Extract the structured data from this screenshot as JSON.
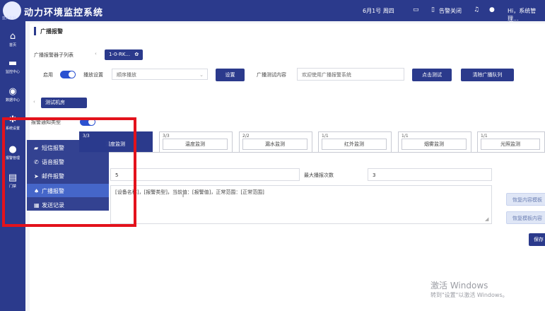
{
  "topbar": {
    "logo_sub": "蓝大化科",
    "title": "动力环境监控系统",
    "date": "6月1号 周四",
    "alarm_close": "告警关闭",
    "user": "Hi，系统管理..."
  },
  "sidebar": [
    {
      "label": "首页",
      "icon": "home-icon"
    },
    {
      "label": "监控中心",
      "icon": "monitor-icon"
    },
    {
      "label": "数据中心",
      "icon": "data-icon"
    },
    {
      "label": "系统设置",
      "icon": "gear-icon"
    },
    {
      "label": "报警管理",
      "icon": "alarm-icon"
    },
    {
      "label": "门禁",
      "icon": "door-icon"
    }
  ],
  "page": {
    "section_title": "广播报警",
    "host_list_label": "广播报警器子列表",
    "host_chip": "1-0-RK...",
    "enable_label": "启用",
    "play_setting_label": "播放设置",
    "play_setting_value": "顺序播放",
    "set_button": "设置",
    "test_content_label": "广播测试内容",
    "test_content_value": "欢迎使用广播报警系统",
    "test_button": "点击测试",
    "clear_button": "清除广播队列",
    "room_chip": "测试机房",
    "notify_label": "报警通知类型",
    "cards": [
      {
        "count": "3/3",
        "name": "湿度监测"
      },
      {
        "count": "3/3",
        "name": "温度监测"
      },
      {
        "count": "2/2",
        "name": "漏水监测"
      },
      {
        "count": "1/1",
        "name": "红外监测"
      },
      {
        "count": "1/1",
        "name": "烟雾监测"
      },
      {
        "count": "1/1",
        "name": "光照监测"
      }
    ],
    "interval_value": "5",
    "max_count_label": "最大播报次数",
    "max_count_value": "3",
    "template_text": "[设备名称]，[报警类型]，当前值：[报警值]，正常范围：[正常范围]",
    "restore_button": "恢复内容模板",
    "recover_button": "恢复模板内容",
    "save_button": "保存"
  },
  "menu": [
    {
      "label": "短信报警",
      "icon": "sms-icon"
    },
    {
      "label": "语音报警",
      "icon": "phone-icon"
    },
    {
      "label": "邮件报警",
      "icon": "mail-icon"
    },
    {
      "label": "广播报警",
      "icon": "bell-icon"
    },
    {
      "label": "发送记录",
      "icon": "record-icon"
    }
  ],
  "watermark": {
    "line1": "激活 Windows",
    "line2": "转到\"设置\"以激活 Windows。"
  },
  "colors": {
    "primary": "#2b3a8c",
    "highlight": "#e3121c"
  }
}
